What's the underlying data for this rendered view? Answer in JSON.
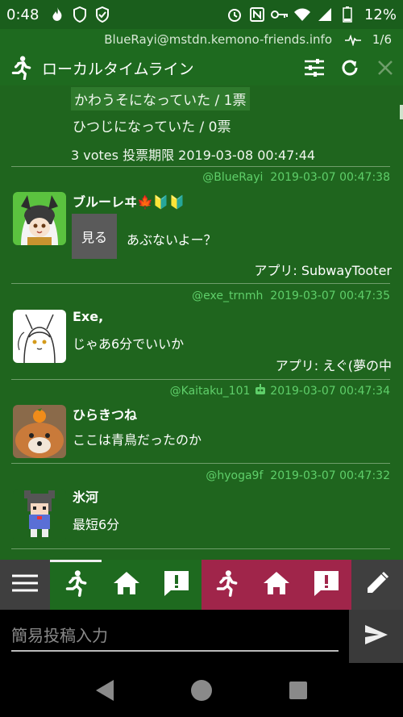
{
  "status_bar": {
    "time": "0:48",
    "battery": "12%",
    "icons": [
      "flame-icon",
      "shield-icon",
      "vpn-shield-icon",
      "alarm-icon",
      "nfc-icon",
      "key-icon",
      "wifi-icon",
      "signal-icon",
      "battery-icon"
    ]
  },
  "column": {
    "account": "BlueRayi@mstdn.kemono-friends.info",
    "position": "1/6",
    "title": "ローカルタイムライン",
    "icons": [
      "run-icon",
      "filter-settings-icon",
      "refresh-icon",
      "close-icon"
    ]
  },
  "timeline": {
    "poll": {
      "options": [
        "かわうそになっていた / 1票",
        "ひつじになっていた / 0票"
      ],
      "summary": "3 votes 投票期限 2019-03-08 00:47:44"
    },
    "posts": [
      {
        "acct": "@BlueRayi",
        "time": "2019-03-07 00:47:38",
        "display_name": "ブルーレヰ🍁🔰🔰",
        "cw_button": "見る",
        "text": "あぶないよー？",
        "app": "アプリ: SubwayTooter"
      },
      {
        "acct": "@exe_trnmh",
        "time": "2019-03-07 00:47:35",
        "display_name": "Exe,",
        "text": "じゃあ6分でいいか",
        "app": "アプリ: えぐ(夢の中"
      },
      {
        "acct": "@Kaitaku_101",
        "bot_icon": "robot-icon",
        "time": "2019-03-07 00:47:34",
        "display_name": "ひらきつね",
        "text": "ここは青鳥だったのか"
      },
      {
        "acct": "@hyoga9f",
        "time": "2019-03-07 00:47:32",
        "display_name": "氷河",
        "text": "最短6分"
      }
    ]
  },
  "tabs": {
    "icons": [
      "menu-icon",
      "run-icon",
      "home-icon",
      "notification-icon",
      "run-icon",
      "home-icon",
      "notification-icon",
      "edit-icon"
    ]
  },
  "post": {
    "placeholder": "簡易投稿入力",
    "send_icon": "send-icon"
  },
  "navigation": {
    "icons": [
      "back-icon",
      "home-circle-icon",
      "recents-icon"
    ]
  },
  "colors": {
    "header_green": "#1e6a1f",
    "timeline_green": "#1f651e",
    "meta_green": "#5fcf6a",
    "secondary_red": "#a0254a"
  }
}
